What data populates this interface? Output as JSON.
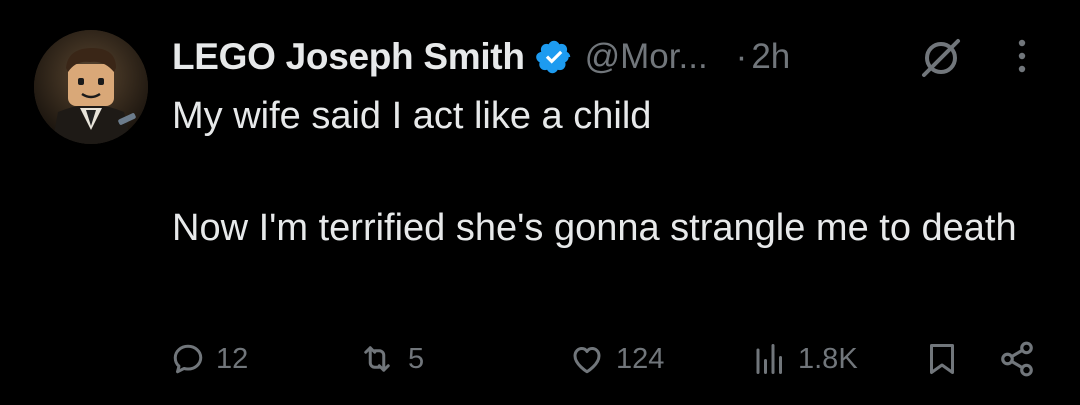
{
  "tweet": {
    "author_name": "LEGO Joseph Smith",
    "handle": "@Mor...",
    "separator": "·",
    "time": "2h",
    "text": "My wife said I act like a child\n\nNow I'm terrified she's gonna strangle me to death",
    "avatar_icon": "lego-minifigure-avatar",
    "verified_icon": "verified-badge-icon",
    "accent_color": "#1d9bf0"
  },
  "actions": {
    "replies": "12",
    "reposts": "5",
    "likes": "124",
    "views": "1.8K"
  }
}
